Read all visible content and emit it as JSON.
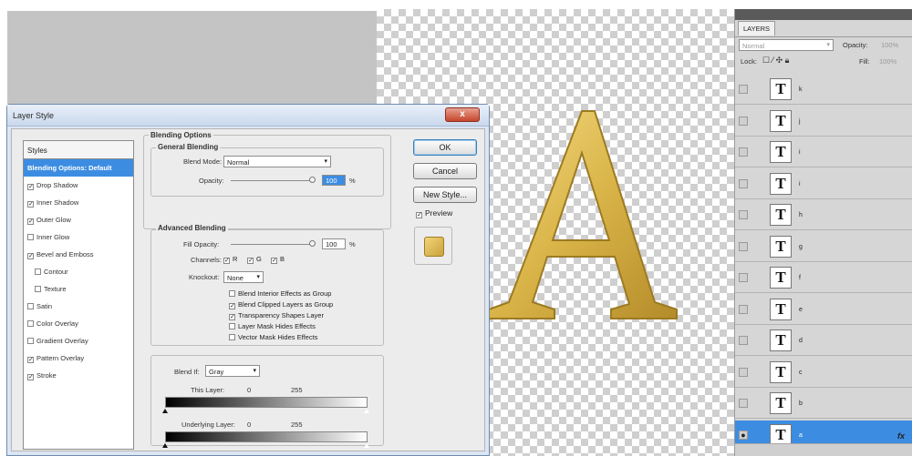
{
  "dialog": {
    "title": "Layer Style",
    "close": "x",
    "styles_header": "Styles",
    "style_items": [
      {
        "label": "Blending Options: Default",
        "checked": null,
        "selected": true,
        "indent": false
      },
      {
        "label": "Drop Shadow",
        "checked": true,
        "selected": false,
        "indent": false
      },
      {
        "label": "Inner Shadow",
        "checked": true,
        "selected": false,
        "indent": false
      },
      {
        "label": "Outer Glow",
        "checked": true,
        "selected": false,
        "indent": false
      },
      {
        "label": "Inner Glow",
        "checked": false,
        "selected": false,
        "indent": false
      },
      {
        "label": "Bevel and Emboss",
        "checked": true,
        "selected": false,
        "indent": false
      },
      {
        "label": "Contour",
        "checked": false,
        "selected": false,
        "indent": true
      },
      {
        "label": "Texture",
        "checked": false,
        "selected": false,
        "indent": true
      },
      {
        "label": "Satin",
        "checked": false,
        "selected": false,
        "indent": false
      },
      {
        "label": "Color Overlay",
        "checked": false,
        "selected": false,
        "indent": false
      },
      {
        "label": "Gradient Overlay",
        "checked": false,
        "selected": false,
        "indent": false
      },
      {
        "label": "Pattern Overlay",
        "checked": true,
        "selected": false,
        "indent": false
      },
      {
        "label": "Stroke",
        "checked": true,
        "selected": false,
        "indent": false
      }
    ],
    "blending_options_title": "Blending Options",
    "general": {
      "title": "General Blending",
      "blend_mode_label": "Blend Mode:",
      "blend_mode_value": "Normal",
      "opacity_label": "Opacity:",
      "opacity_value": "100",
      "percent": "%"
    },
    "advanced": {
      "title": "Advanced Blending",
      "fill_opacity_label": "Fill Opacity:",
      "fill_opacity_value": "100",
      "percent": "%",
      "channels_label": "Channels:",
      "channel_r": "R",
      "channel_g": "G",
      "channel_b": "B",
      "knockout_label": "Knockout:",
      "knockout_value": "None",
      "options": [
        {
          "label": "Blend Interior Effects as Group",
          "checked": false
        },
        {
          "label": "Blend Clipped Layers as Group",
          "checked": true
        },
        {
          "label": "Transparency Shapes Layer",
          "checked": true
        },
        {
          "label": "Layer Mask Hides Effects",
          "checked": false
        },
        {
          "label": "Vector Mask Hides Effects",
          "checked": false
        }
      ]
    },
    "blend_if": {
      "label": "Blend If:",
      "value": "Gray",
      "this_layer_label": "This Layer:",
      "this_layer_min": "0",
      "this_layer_max": "255",
      "underlying_label": "Underlying Layer:",
      "underlying_min": "0",
      "underlying_max": "255"
    },
    "buttons": {
      "ok": "OK",
      "cancel": "Cancel",
      "new_style": "New Style...",
      "preview": "Preview"
    }
  },
  "layers_panel": {
    "tab": "LAYERS",
    "blend_mode": "Normal",
    "opacity_label": "Opacity:",
    "opacity_value": "100%",
    "lock_label": "Lock:",
    "fill_label": "Fill:",
    "fill_value": "100%",
    "layers": [
      {
        "name": "k",
        "selected": false,
        "fx": false
      },
      {
        "name": "j",
        "selected": false,
        "fx": false
      },
      {
        "name": "i",
        "selected": false,
        "fx": false
      },
      {
        "name": "i",
        "selected": false,
        "fx": false
      },
      {
        "name": "h",
        "selected": false,
        "fx": false
      },
      {
        "name": "g",
        "selected": false,
        "fx": false
      },
      {
        "name": "f",
        "selected": false,
        "fx": false
      },
      {
        "name": "e",
        "selected": false,
        "fx": false
      },
      {
        "name": "d",
        "selected": false,
        "fx": false
      },
      {
        "name": "c",
        "selected": false,
        "fx": false
      },
      {
        "name": "b",
        "selected": false,
        "fx": false
      },
      {
        "name": "a",
        "selected": true,
        "fx": true
      }
    ],
    "thumb_glyph": "T",
    "fx_label": "fx"
  },
  "colors": {
    "accent": "#3c8de2",
    "gold": "#d9b448"
  }
}
